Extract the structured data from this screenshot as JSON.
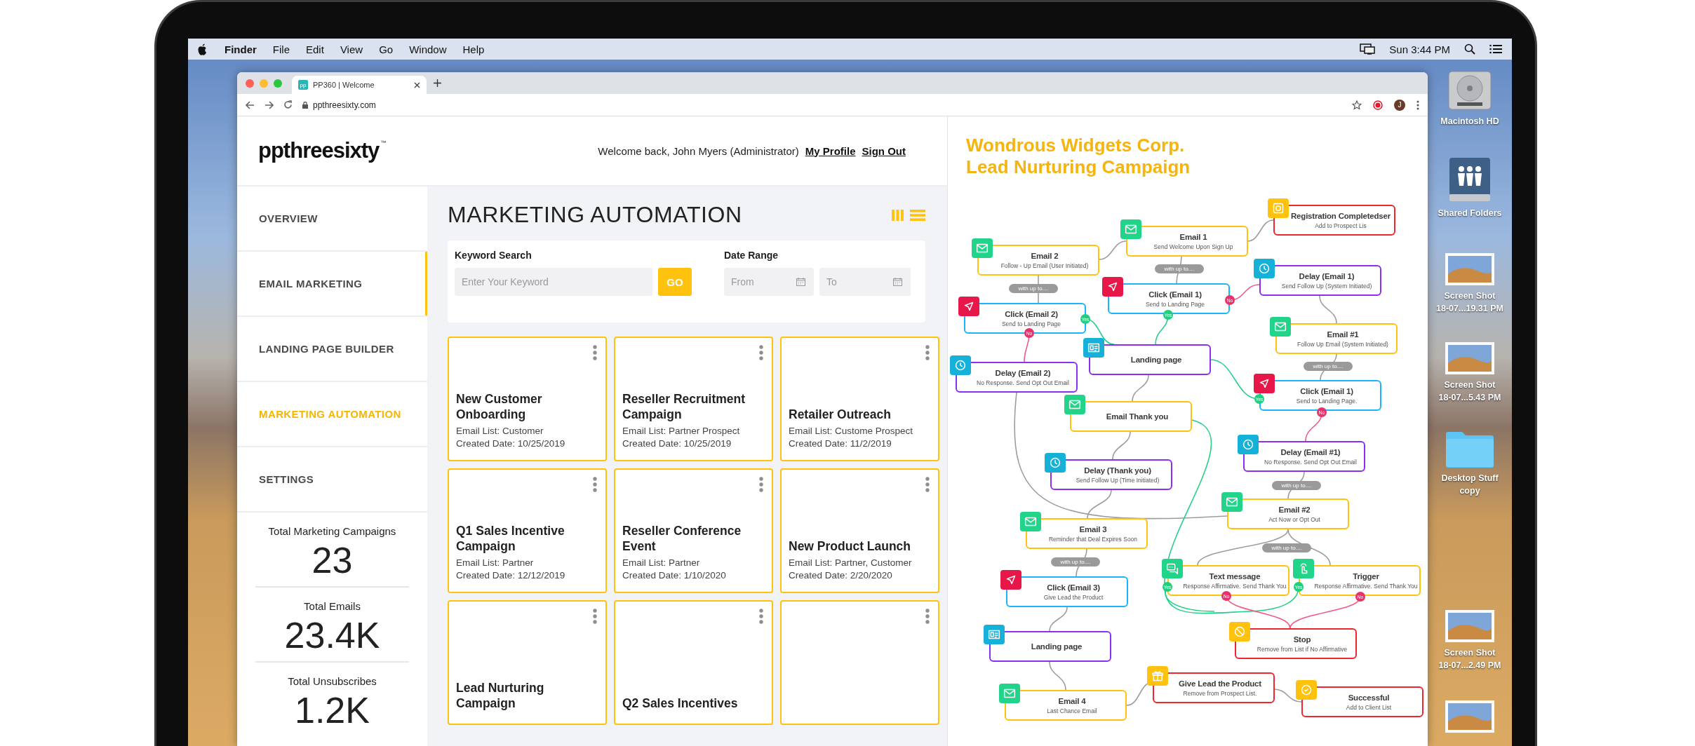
{
  "menubar": {
    "app": "Finder",
    "menus": [
      "File",
      "Edit",
      "View",
      "Go",
      "Window",
      "Help"
    ],
    "clock": "Sun 3:44 PM"
  },
  "browser": {
    "favicon": "pp",
    "tab_title": "PP360 | Welcome",
    "url": "ppthreesixty.com",
    "profile": "J"
  },
  "app": {
    "logo": "ppthreesixty",
    "logo_mark": "™",
    "welcome": "Welcome back, John Myers (Administrator)",
    "links": [
      "My Profile",
      "Sign Out"
    ],
    "sidebar": [
      {
        "label": "OVERVIEW",
        "selected": false,
        "hover": false
      },
      {
        "label": "EMAIL MARKETING",
        "selected": false,
        "hover": true
      },
      {
        "label": "LANDING PAGE BUILDER",
        "selected": false,
        "hover": false
      },
      {
        "label": "MARKETING AUTOMATION",
        "selected": true,
        "hover": false
      },
      {
        "label": "SETTINGS",
        "selected": false,
        "hover": false
      }
    ],
    "stats": [
      {
        "label": "Total Marketing Campaigns",
        "value": "23"
      },
      {
        "label": "Total Emails",
        "value": "23.4K"
      },
      {
        "label": "Total Unsubscribes",
        "value": "1.2K"
      }
    ],
    "page_title": "MARKETING AUTOMATION",
    "search": {
      "keyword_label": "Keyword Search",
      "placeholder": "Enter Your Keyword",
      "button": "GO",
      "date_label": "Date Range",
      "from_placeholder": "From",
      "to_placeholder": "To"
    },
    "campaigns": [
      {
        "kind": "campaign",
        "title": "New Customer Onboarding",
        "email_list": "Email List: Customer",
        "created": "Created Date: 10/25/2019"
      },
      {
        "kind": "campaign",
        "title": "Reseller Recruitment Campaign",
        "email_list": "Email List: Partner Prospect",
        "created": "Created Date: 10/25/2019"
      },
      {
        "kind": "campaign",
        "title": "Retailer Outreach",
        "email_list": "Email List: Custome Prospect",
        "created": "Created Date: 11/2/2019"
      },
      {
        "kind": "campaign",
        "title": "Q1 Sales Incentive Campaign",
        "email_list": "Email List: Partner",
        "created": "Created Date: 12/12/2019"
      },
      {
        "kind": "campaign",
        "title": "Reseller Conference Event",
        "email_list": "Email List: Partner",
        "created": "Created Date: 1/10/2020"
      },
      {
        "kind": "campaign",
        "title": "New Product Launch",
        "email_list": "Email List: Partner, Customer",
        "created": "Created Date: 2/20/2020"
      },
      {
        "kind": "campaign",
        "title": "Lead Nurturing Campaign"
      },
      {
        "kind": "campaign",
        "title": "Q2 Sales Incentives"
      },
      {
        "kind": "campaign"
      }
    ]
  },
  "flow": {
    "title_lines": [
      "Wondrous Widgets Corp.",
      "Lead Nurturing Campaign"
    ],
    "nodes": [
      {
        "kind": "registration",
        "title": "Registration Completedser",
        "subtitle": "Add to Prospect Lis"
      },
      {
        "kind": "email",
        "title": "Email 1",
        "subtitle": "Send Welcome Upon Sign Up"
      },
      {
        "kind": "email",
        "title": "Email 2",
        "subtitle": "Follow - Up Email (User Initiated)"
      },
      {
        "kind": "delay",
        "title": "Delay (Email 1)",
        "subtitle": "Send Follow Up (System Initiated)"
      },
      {
        "kind": "click",
        "title": "Click (Email 1)",
        "subtitle": "Send to Landing Page"
      },
      {
        "kind": "click",
        "title": "Click (Email 2)",
        "subtitle": "Send to Landing Page"
      },
      {
        "kind": "email",
        "title": "Email #1",
        "subtitle": "Follow Up Email (System Initiated)"
      },
      {
        "kind": "landing",
        "title": "Landing page"
      },
      {
        "kind": "delay",
        "title": "Delay (Email 2)",
        "subtitle": "No Response. Send Opt Out Email"
      },
      {
        "kind": "click",
        "title": "Click (Email 1)",
        "subtitle": "Send to Landing Page."
      },
      {
        "kind": "email",
        "title": "Email Thank you"
      },
      {
        "kind": "delay",
        "title": "Delay (Email #1)",
        "subtitle": "No Response. Send Opt Out Email"
      },
      {
        "kind": "delay",
        "title": "Delay (Thank you)",
        "subtitle": "Send Follow Up (Time Initiated)"
      },
      {
        "kind": "email",
        "title": "Email #2",
        "subtitle": "Act Now or Opt Out"
      },
      {
        "kind": "email",
        "title": "Email 3",
        "subtitle": "Reminder that Deal Expires Soon"
      },
      {
        "kind": "click",
        "title": "Click (Email 3)",
        "subtitle": "Give Lead the Product"
      },
      {
        "kind": "text",
        "title": "Text message",
        "subtitle": "Response Affirmative. Send Thank You"
      },
      {
        "kind": "trigger",
        "title": "Trigger",
        "subtitle": "Response Affirmative. Send Thank You"
      },
      {
        "kind": "landing",
        "title": "Landing page"
      },
      {
        "kind": "stop",
        "title": "Stop",
        "subtitle": "Remove from List if No Affirmative"
      },
      {
        "kind": "email",
        "title": "Email 4",
        "subtitle": "Last Chance Email"
      },
      {
        "kind": "gift",
        "title": "Give Lead the Product",
        "subtitle": "Remove from Prospect List."
      },
      {
        "kind": "success",
        "title": "Successful",
        "subtitle": "Add to Client List"
      }
    ],
    "pills": [
      "with up to....",
      "with up to....",
      "with up to....",
      "with up to....",
      "with up to....",
      "with up to...."
    ],
    "badges": [
      {
        "kind": "no",
        "label": "No"
      },
      {
        "kind": "yes",
        "label": "Yes"
      },
      {
        "kind": "yes",
        "label": "Yes"
      },
      {
        "kind": "no",
        "label": "No"
      },
      {
        "kind": "yes",
        "label": "Yes"
      },
      {
        "kind": "no",
        "label": "No"
      },
      {
        "kind": "yes",
        "label": "Yes"
      },
      {
        "kind": "no",
        "label": "No"
      },
      {
        "kind": "yes",
        "label": "Yes"
      },
      {
        "kind": "no",
        "label": "No"
      }
    ]
  },
  "desktop_icons": [
    {
      "kind": "drive",
      "label": [
        "Macintosh HD"
      ]
    },
    {
      "kind": "shared",
      "label": [
        "Shared Folders"
      ]
    },
    {
      "kind": "screenshot",
      "label": [
        "Screen Shot",
        "18-07...19.31 PM"
      ]
    },
    {
      "kind": "screenshot",
      "label": [
        "Screen Shot",
        "18-07...5.43 PM"
      ]
    },
    {
      "kind": "folder",
      "label": [
        "Desktop Stuff",
        "copy"
      ]
    },
    {
      "kind": "screenshot",
      "label": [
        "Screen Shot",
        "18-07...2.49 PM"
      ]
    },
    {
      "kind": "screenshot"
    }
  ]
}
